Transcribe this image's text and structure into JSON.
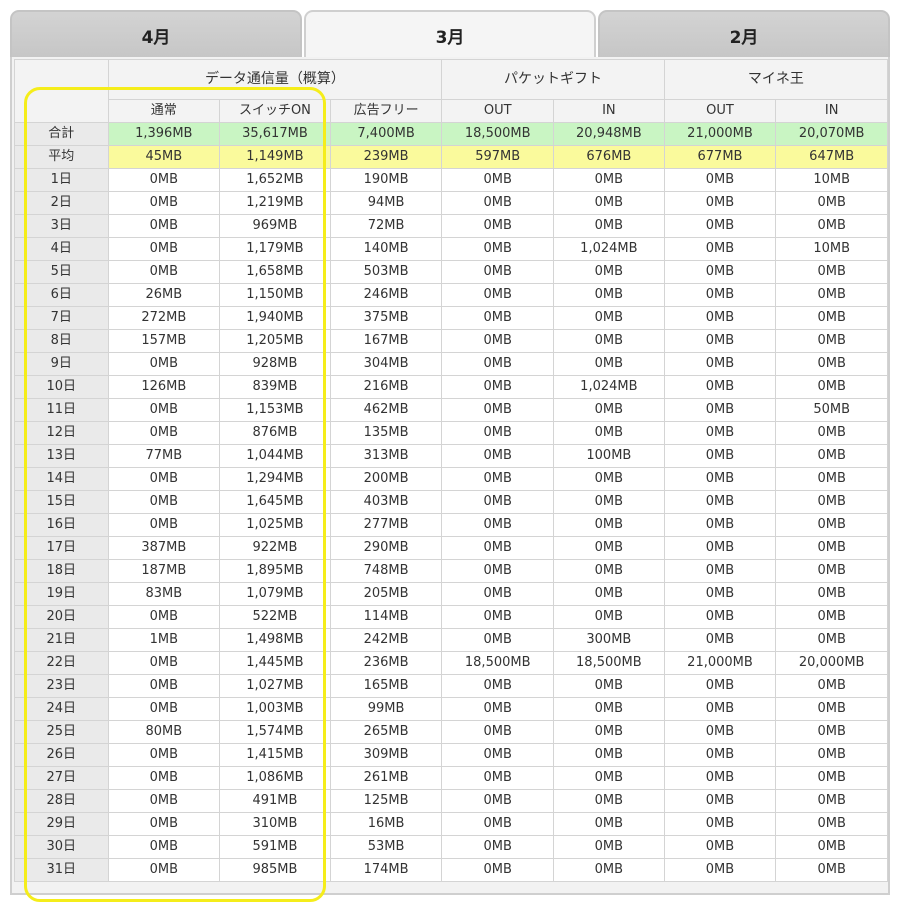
{
  "tabs": [
    {
      "label": "4月",
      "active": false
    },
    {
      "label": "3月",
      "active": true
    },
    {
      "label": "2月",
      "active": false
    }
  ],
  "table": {
    "group_headers": [
      "データ通信量（概算）",
      "パケットギフト",
      "マイネ王"
    ],
    "sub_headers": [
      "通常",
      "スイッチON",
      "広告フリー",
      "OUT",
      "IN",
      "OUT",
      "IN"
    ],
    "total": {
      "label": "合計",
      "values": [
        "1,396MB",
        "35,617MB",
        "7,400MB",
        "18,500MB",
        "20,948MB",
        "21,000MB",
        "20,070MB"
      ]
    },
    "average": {
      "label": "平均",
      "values": [
        "45MB",
        "1,149MB",
        "239MB",
        "597MB",
        "676MB",
        "677MB",
        "647MB"
      ]
    },
    "days": [
      {
        "label": "1日",
        "values": [
          "0MB",
          "1,652MB",
          "190MB",
          "0MB",
          "0MB",
          "0MB",
          "10MB"
        ]
      },
      {
        "label": "2日",
        "values": [
          "0MB",
          "1,219MB",
          "94MB",
          "0MB",
          "0MB",
          "0MB",
          "0MB"
        ]
      },
      {
        "label": "3日",
        "values": [
          "0MB",
          "969MB",
          "72MB",
          "0MB",
          "0MB",
          "0MB",
          "0MB"
        ]
      },
      {
        "label": "4日",
        "values": [
          "0MB",
          "1,179MB",
          "140MB",
          "0MB",
          "1,024MB",
          "0MB",
          "10MB"
        ]
      },
      {
        "label": "5日",
        "values": [
          "0MB",
          "1,658MB",
          "503MB",
          "0MB",
          "0MB",
          "0MB",
          "0MB"
        ]
      },
      {
        "label": "6日",
        "values": [
          "26MB",
          "1,150MB",
          "246MB",
          "0MB",
          "0MB",
          "0MB",
          "0MB"
        ]
      },
      {
        "label": "7日",
        "values": [
          "272MB",
          "1,940MB",
          "375MB",
          "0MB",
          "0MB",
          "0MB",
          "0MB"
        ]
      },
      {
        "label": "8日",
        "values": [
          "157MB",
          "1,205MB",
          "167MB",
          "0MB",
          "0MB",
          "0MB",
          "0MB"
        ]
      },
      {
        "label": "9日",
        "values": [
          "0MB",
          "928MB",
          "304MB",
          "0MB",
          "0MB",
          "0MB",
          "0MB"
        ]
      },
      {
        "label": "10日",
        "values": [
          "126MB",
          "839MB",
          "216MB",
          "0MB",
          "1,024MB",
          "0MB",
          "0MB"
        ]
      },
      {
        "label": "11日",
        "values": [
          "0MB",
          "1,153MB",
          "462MB",
          "0MB",
          "0MB",
          "0MB",
          "50MB"
        ]
      },
      {
        "label": "12日",
        "values": [
          "0MB",
          "876MB",
          "135MB",
          "0MB",
          "0MB",
          "0MB",
          "0MB"
        ]
      },
      {
        "label": "13日",
        "values": [
          "77MB",
          "1,044MB",
          "313MB",
          "0MB",
          "100MB",
          "0MB",
          "0MB"
        ]
      },
      {
        "label": "14日",
        "values": [
          "0MB",
          "1,294MB",
          "200MB",
          "0MB",
          "0MB",
          "0MB",
          "0MB"
        ]
      },
      {
        "label": "15日",
        "values": [
          "0MB",
          "1,645MB",
          "403MB",
          "0MB",
          "0MB",
          "0MB",
          "0MB"
        ]
      },
      {
        "label": "16日",
        "values": [
          "0MB",
          "1,025MB",
          "277MB",
          "0MB",
          "0MB",
          "0MB",
          "0MB"
        ]
      },
      {
        "label": "17日",
        "values": [
          "387MB",
          "922MB",
          "290MB",
          "0MB",
          "0MB",
          "0MB",
          "0MB"
        ]
      },
      {
        "label": "18日",
        "values": [
          "187MB",
          "1,895MB",
          "748MB",
          "0MB",
          "0MB",
          "0MB",
          "0MB"
        ]
      },
      {
        "label": "19日",
        "values": [
          "83MB",
          "1,079MB",
          "205MB",
          "0MB",
          "0MB",
          "0MB",
          "0MB"
        ]
      },
      {
        "label": "20日",
        "values": [
          "0MB",
          "522MB",
          "114MB",
          "0MB",
          "0MB",
          "0MB",
          "0MB"
        ]
      },
      {
        "label": "21日",
        "values": [
          "1MB",
          "1,498MB",
          "242MB",
          "0MB",
          "300MB",
          "0MB",
          "0MB"
        ]
      },
      {
        "label": "22日",
        "values": [
          "0MB",
          "1,445MB",
          "236MB",
          "18,500MB",
          "18,500MB",
          "21,000MB",
          "20,000MB"
        ]
      },
      {
        "label": "23日",
        "values": [
          "0MB",
          "1,027MB",
          "165MB",
          "0MB",
          "0MB",
          "0MB",
          "0MB"
        ]
      },
      {
        "label": "24日",
        "values": [
          "0MB",
          "1,003MB",
          "99MB",
          "0MB",
          "0MB",
          "0MB",
          "0MB"
        ]
      },
      {
        "label": "25日",
        "values": [
          "80MB",
          "1,574MB",
          "265MB",
          "0MB",
          "0MB",
          "0MB",
          "0MB"
        ]
      },
      {
        "label": "26日",
        "values": [
          "0MB",
          "1,415MB",
          "309MB",
          "0MB",
          "0MB",
          "0MB",
          "0MB"
        ]
      },
      {
        "label": "27日",
        "values": [
          "0MB",
          "1,086MB",
          "261MB",
          "0MB",
          "0MB",
          "0MB",
          "0MB"
        ]
      },
      {
        "label": "28日",
        "values": [
          "0MB",
          "491MB",
          "125MB",
          "0MB",
          "0MB",
          "0MB",
          "0MB"
        ]
      },
      {
        "label": "29日",
        "values": [
          "0MB",
          "310MB",
          "16MB",
          "0MB",
          "0MB",
          "0MB",
          "0MB"
        ]
      },
      {
        "label": "30日",
        "values": [
          "0MB",
          "591MB",
          "53MB",
          "0MB",
          "0MB",
          "0MB",
          "0MB"
        ]
      },
      {
        "label": "31日",
        "values": [
          "0MB",
          "985MB",
          "174MB",
          "0MB",
          "0MB",
          "0MB",
          "0MB"
        ]
      }
    ]
  },
  "colors": {
    "total_row": "#c9f5c3",
    "average_row": "#fafa9c",
    "highlight": "#f5ed1a"
  }
}
